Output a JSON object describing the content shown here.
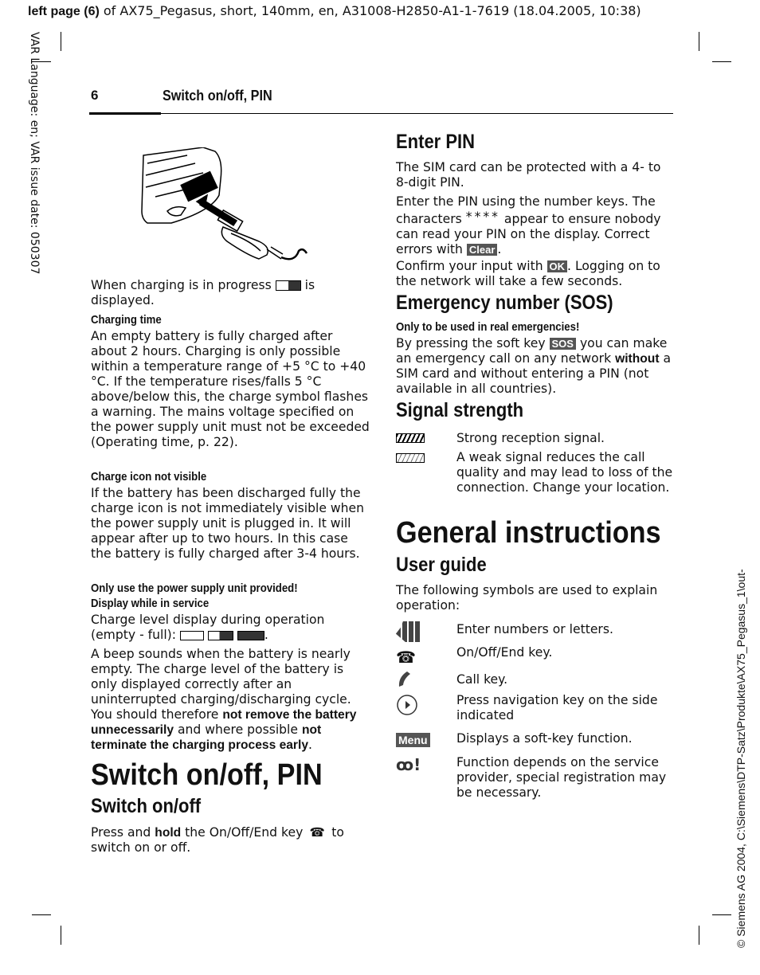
{
  "top_header": {
    "bold": "left page (6)",
    "rest": " of AX75_Pegasus, short, 140mm, en, A31008-H2850-A1-1-7619 (18.04.2005, 10:38)"
  },
  "left_margin": "VAR Language: en; VAR issue date: 050307",
  "right_margin": "© Siemens AG 2004, C:\\Siemens\\DTP-Satz\\Produkte\\AX75_Pegasus_1\\out-",
  "running_head": {
    "page": "6",
    "title": "Switch on/off, PIN"
  },
  "left": {
    "charging_text_a": "When charging is in progress ",
    "charging_text_b": " is displayed.",
    "charging_time_heading": "Charging time",
    "charging_time_text": "An empty battery is fully charged after about 2 hours. Charging is only possible within a temperature range of +5 °C to +40 °C. If the temperature rises/falls 5 °C above/below this, the charge symbol flashes a warning. The mains voltage specified on the power supply unit must not be exceeded (Operating time, p. 22).",
    "charge_icon_heading": "Charge icon not visible",
    "charge_icon_text": "If the battery has been discharged fully the charge icon is not immediately visible when the power supply unit is plugged in. It will appear after up to two hours. In this case the battery is fully charged after 3-4 hours.",
    "warning": "Only use the power supply unit provided!",
    "display_heading": "Display while in service",
    "display_text": "Charge level display during operation (empty - full): ",
    "beep_a": "A beep sounds when the battery is nearly empty. The charge level of the battery is only displayed correctly after an uninterrupted charging/discharging cycle. You should therefore ",
    "beep_b": "not remove the battery unnecessarily",
    "beep_c": " and where possible ",
    "beep_d": "not terminate the charging process early",
    "beep_e": ".",
    "section_title": "Switch on/off, PIN",
    "switch_heading": "Switch on/off",
    "switch_a": "Press and ",
    "switch_b": "hold",
    "switch_c": " the On/Off/End key ",
    "switch_d": " to switch on or off."
  },
  "right": {
    "enter_pin_heading": "Enter PIN",
    "pin_text1": "The SIM card can be protected with a 4- to 8-digit PIN.",
    "pin_text2_a": "Enter the PIN using the number keys. The characters ",
    "pin_stars": "****",
    "pin_text2_b": " appear to ensure nobody can read your PIN on the display. Correct errors with ",
    "clear_key": "Clear",
    "pin_text2_c": ".",
    "pin_text3_a": "Confirm your input with ",
    "ok_key": "OK",
    "pin_text3_b": ". Logging on to the network will take a few seconds.",
    "sos_heading": "Emergency number (SOS)",
    "sos_warning": "Only to be used in real emergencies!",
    "sos_a": "By pressing the soft key ",
    "sos_key": "SOS",
    "sos_b": " you can make an emergency call on any network ",
    "sos_c": "without",
    "sos_d": " a SIM card and without entering a PIN (not available in all countries).",
    "signal_heading": "Signal strength",
    "signal_items": [
      {
        "icon": "signal-strong-icon",
        "text": "Strong reception signal."
      },
      {
        "icon": "signal-weak-icon",
        "text": "A weak signal reduces the call quality and may lead to loss of the connection. Change your location."
      }
    ],
    "general_title": "General instructions",
    "user_guide_heading": "User guide",
    "user_guide_text": "The following symbols are used to explain operation:",
    "symbols": [
      {
        "icon": "keypad-hand-icon",
        "text": "Enter numbers or letters."
      },
      {
        "icon": "end-key-icon",
        "text": "On/Off/End key."
      },
      {
        "icon": "call-key-icon",
        "text": "Call key."
      },
      {
        "icon": "navigation-key-icon",
        "text": "Press navigation key on the side indicated"
      },
      {
        "icon": "softkey-icon",
        "key": "Menu",
        "text": "Displays a soft-key function."
      },
      {
        "icon": "service-provider-icon",
        "text": "Function depends on the service provider, special registration may be necessary."
      }
    ]
  }
}
